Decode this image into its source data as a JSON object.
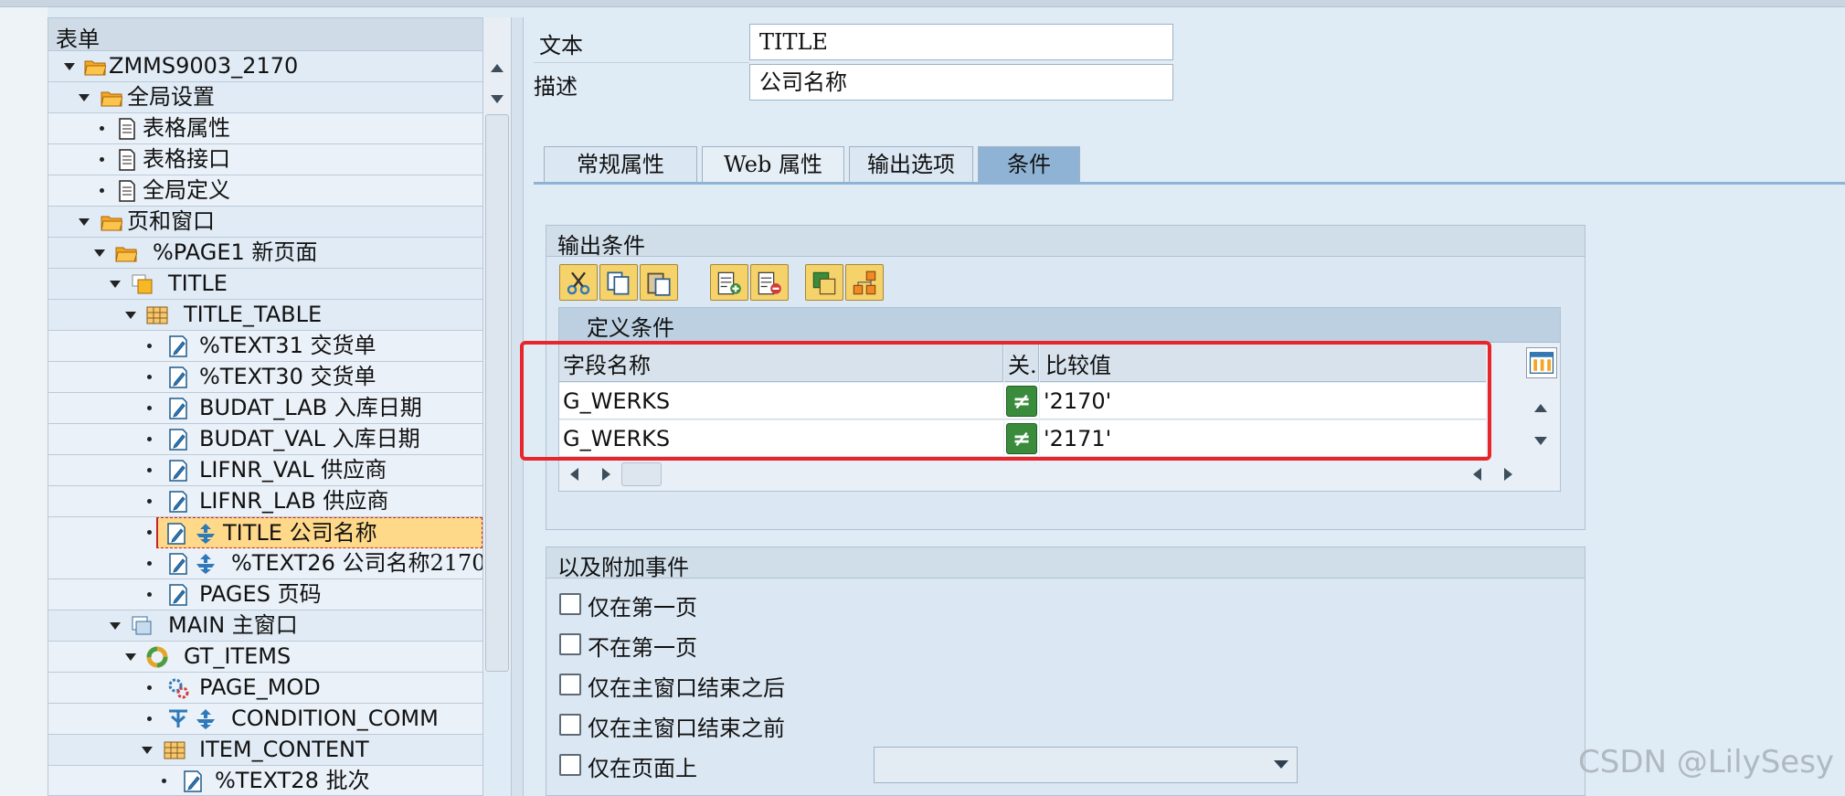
{
  "tree": {
    "header": "表单",
    "rows": [
      {
        "label": "ZMMS9003_2170",
        "cn": ""
      },
      {
        "label": "",
        "cn": "全局设置"
      },
      {
        "label": "",
        "cn": "表格属性"
      },
      {
        "label": "",
        "cn": "表格接口"
      },
      {
        "label": "",
        "cn": "全局定义"
      },
      {
        "label": "",
        "cn": "页和窗口"
      },
      {
        "label": "%PAGE1",
        "cn": "新页面"
      },
      {
        "label": "TITLE",
        "cn": ""
      },
      {
        "label": "TITLE_TABLE",
        "cn": ""
      },
      {
        "label": "%TEXT31",
        "cn": "交货单"
      },
      {
        "label": "%TEXT30",
        "cn": "交货单"
      },
      {
        "label": "BUDAT_LAB",
        "cn": "入库日期"
      },
      {
        "label": "BUDAT_VAL",
        "cn": "入库日期"
      },
      {
        "label": "LIFNR_VAL",
        "cn": "供应商"
      },
      {
        "label": "LIFNR_LAB",
        "cn": "供应商"
      },
      {
        "label": "TITLE",
        "cn": "公司名称"
      },
      {
        "label": "%TEXT26",
        "cn": "公司名称2170"
      },
      {
        "label": "PAGES",
        "cn": "页码"
      },
      {
        "label": "MAIN",
        "cn": "主窗口"
      },
      {
        "label": "GT_ITEMS",
        "cn": ""
      },
      {
        "label": "PAGE_MOD",
        "cn": ""
      },
      {
        "label": "CONDITION_COMM",
        "cn": ""
      },
      {
        "label": "ITEM_CONTENT",
        "cn": ""
      },
      {
        "label": "%TEXT28",
        "cn": "批次"
      }
    ]
  },
  "header_fields": {
    "text_label": "文本",
    "text_value": "TITLE",
    "desc_label": "描述",
    "desc_value": "公司名称"
  },
  "tabs": [
    "常规属性",
    "Web 属性",
    "输出选项",
    "条件"
  ],
  "active_tab": "条件",
  "output_conditions": {
    "title": "输出条件",
    "grid_title": "定义条件",
    "columns": [
      "字段名称",
      "关.",
      "比较值"
    ],
    "rows": [
      {
        "field": "G_WERKS",
        "op": "≠",
        "value": "'2170'"
      },
      {
        "field": "G_WERKS",
        "op": "≠",
        "value": "'2171'"
      }
    ]
  },
  "additional_events": {
    "title": "以及附加事件",
    "options": [
      "仅在第一页",
      "不在第一页",
      "仅在主窗口结束之后",
      "仅在主窗口结束之前",
      "仅在页面上"
    ],
    "page_dropdown_value": ""
  },
  "watermark": "CSDN @LilySesy"
}
